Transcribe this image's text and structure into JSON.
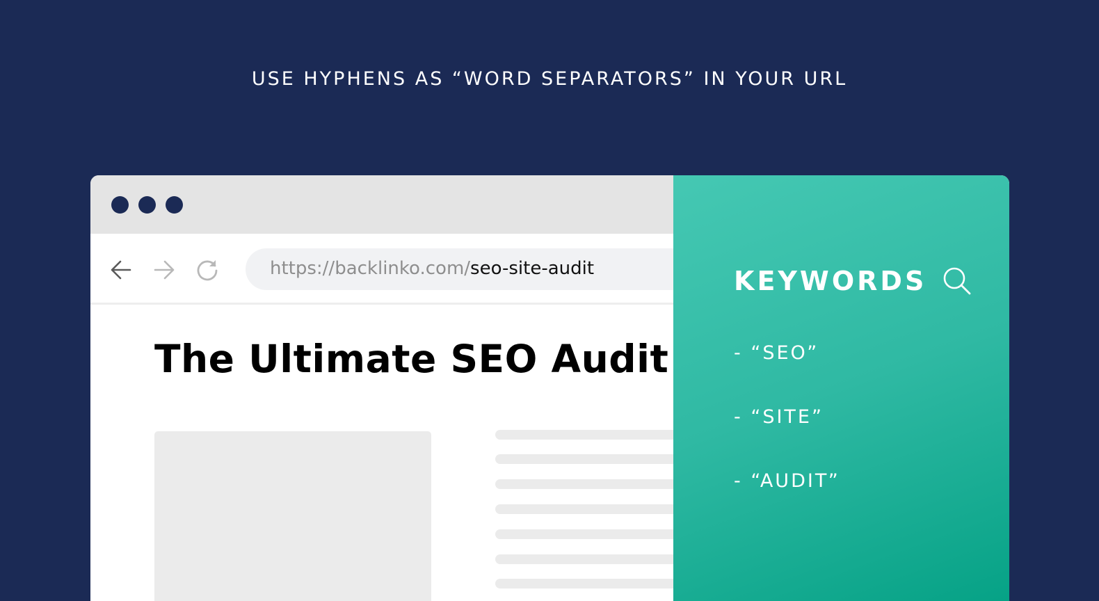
{
  "headline": "USE HYPHENS AS “WORD SEPARATORS” IN YOUR URL",
  "colors": {
    "background": "#1b2a55",
    "titlebar": "#e4e4e4",
    "window_dots": "#1b2a55",
    "address_bar": "#f1f2f4",
    "placeholder": "#ebebeb",
    "panel_gradient_start": "#45c8b3",
    "panel_gradient_end": "#06a286"
  },
  "browser": {
    "window_controls": [
      "dot-1",
      "dot-2",
      "dot-3"
    ],
    "nav": {
      "back_icon": "arrow-left-icon",
      "forward_icon": "arrow-right-icon",
      "reload_icon": "reload-icon"
    },
    "address_bar": {
      "url_base": "https://backlinko.com/",
      "url_slug": "seo-site-audit"
    },
    "page": {
      "title": "The Ultimate SEO Audit [V"
    }
  },
  "keywords_panel": {
    "heading": "KEYWORDS",
    "icon": "search-icon",
    "items": [
      "- “SEO”",
      "- “SITE”",
      "- “AUDIT”"
    ]
  }
}
